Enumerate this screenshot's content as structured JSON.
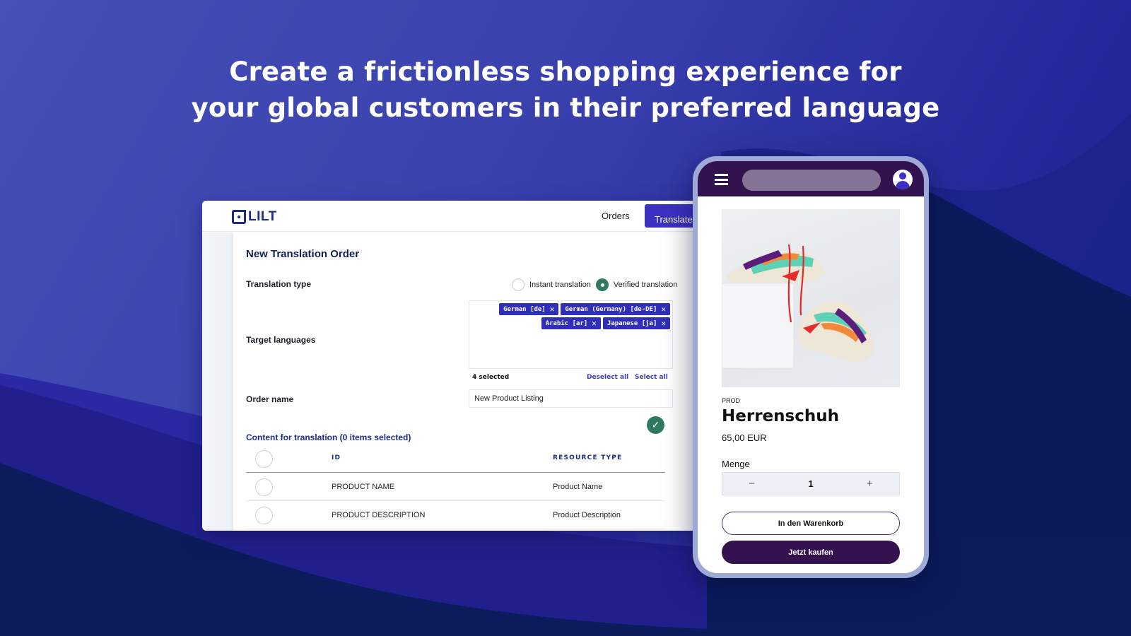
{
  "headline": {
    "line1": "Create a frictionless shopping experience for",
    "line2": "your global customers in their preferred language"
  },
  "colors": {
    "brand_primary": "#3b32c2",
    "brand_navy": "#1b2c86",
    "success_green": "#2f7a5d",
    "phone_bar": "#32124f",
    "buy_button": "#33124f",
    "background_dark": "#0b1a5a",
    "background_light": "#4550b8"
  },
  "desktop": {
    "logo_text": "LILT",
    "nav": {
      "orders_label": "Orders",
      "translate_label": "Translate"
    },
    "page_title": "New Translation Order",
    "translation_type": {
      "label": "Translation type",
      "options": [
        {
          "label": "Instant translation",
          "selected": false
        },
        {
          "label": "Verified translation",
          "selected": true
        }
      ]
    },
    "target_languages": {
      "label": "Target languages",
      "chips": [
        {
          "label": "German [de]"
        },
        {
          "label": "German (Germany) [de-DE]"
        },
        {
          "label": "Arabic [ar]"
        },
        {
          "label": "Japanese [ja]"
        }
      ],
      "selected_count": "4 selected",
      "deselect_all_label": "Deselect all",
      "select_all_label": "Select all"
    },
    "order_name": {
      "label": "Order name",
      "value": "New Product Listing"
    },
    "content_section": {
      "title": "Content for translation (0 items selected)",
      "columns": [
        "ID",
        "RESOURCE TYPE"
      ],
      "rows": [
        {
          "id": "PRODUCT NAME",
          "type": "Product Name",
          "selected": false
        },
        {
          "id": "PRODUCT DESCRIPTION",
          "type": "Product Description",
          "selected": false
        }
      ]
    }
  },
  "phone": {
    "icons": {
      "menu": "hamburger-icon",
      "user": "user-avatar-icon",
      "confirm": "check-icon"
    },
    "product": {
      "tag": "PROD",
      "name": "Herrenschuh",
      "price": "65,00 EUR",
      "image": "sneakers-on-white-block"
    },
    "quantity": {
      "label": "Menge",
      "value": "1",
      "decrement": "−",
      "increment": "+"
    },
    "add_to_cart_label": "In den Warenkorb",
    "buy_now_label": "Jetzt kaufen"
  }
}
